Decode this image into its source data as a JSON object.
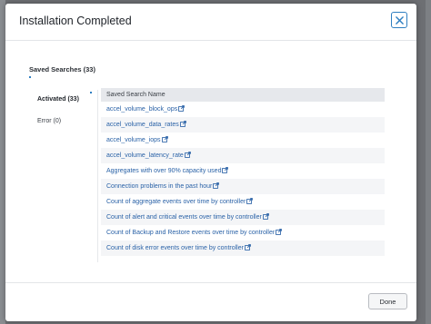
{
  "modal": {
    "title": "Installation Completed",
    "close_icon": "close-icon"
  },
  "section": {
    "tab_label": "Saved Searches (33)"
  },
  "side_tabs": [
    {
      "label": "Activated (33)",
      "active": true
    },
    {
      "label": "Error (0)",
      "active": false
    }
  ],
  "table": {
    "header": "Saved Search Name",
    "rows": [
      "accel_volume_block_ops",
      "accel_volume_data_rates",
      "accel_volume_iops",
      "accel_volume_latency_rate",
      "Aggregates with over 90% capacity used",
      "Connection problems in the past hour",
      "Count of aggregate events over time by controller",
      "Count of alert and critical events over time by controller",
      "Count of Backup and Restore events over time by controller",
      "Count of disk error events over time by controller"
    ],
    "link_icon": "external-link-icon"
  },
  "footer": {
    "done_label": "Done"
  },
  "colors": {
    "accent": "#2f7fc1",
    "link": "#2a62a7"
  }
}
